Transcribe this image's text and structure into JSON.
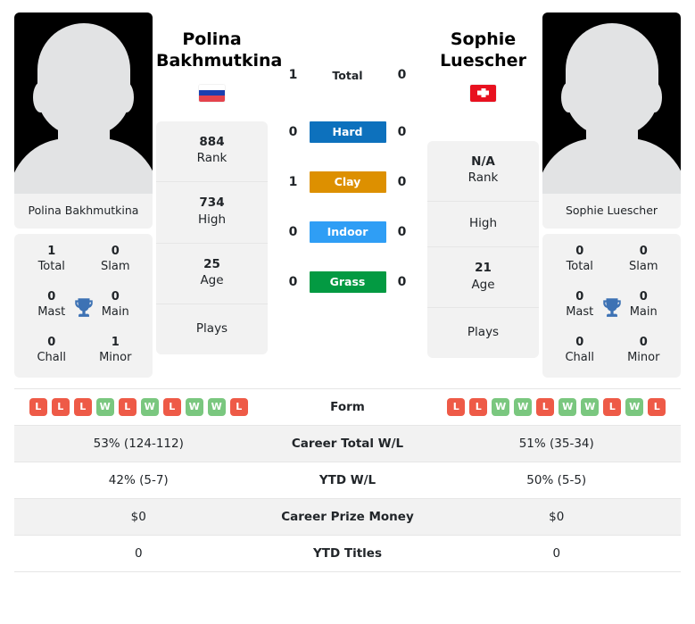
{
  "players": {
    "left": {
      "name": "Polina Bakhmutkina",
      "display_name_line1": "Polina",
      "display_name_line2": "Bakhmutkina",
      "country_flag": "russia-flag",
      "avatar": "player-avatar-placeholder",
      "titles": [
        {
          "value": "1",
          "label": "Total"
        },
        {
          "value": "0",
          "label": "Slam"
        },
        {
          "value": "0",
          "label": "Mast"
        },
        {
          "value": "0",
          "label": "Main"
        },
        {
          "value": "0",
          "label": "Chall"
        },
        {
          "value": "1",
          "label": "Minor"
        }
      ],
      "rank": {
        "value": "884",
        "label": "Rank"
      },
      "high": {
        "value": "734",
        "label": "High"
      },
      "age": {
        "value": "25",
        "label": "Age"
      },
      "plays": {
        "value": "",
        "label": "Plays"
      },
      "form": [
        "L",
        "L",
        "L",
        "W",
        "L",
        "W",
        "L",
        "W",
        "W",
        "L"
      ],
      "career_total_wl": "53% (124-112)",
      "ytd_wl": "42% (5-7)",
      "career_prize_money": "$0",
      "ytd_titles": "0",
      "surface_wins": {
        "total": "1",
        "hard": "0",
        "clay": "1",
        "indoor": "0",
        "grass": "0"
      }
    },
    "right": {
      "name": "Sophie Luescher",
      "display_name_line1": "Sophie",
      "display_name_line2": "Luescher",
      "country_flag": "switzerland-flag",
      "avatar": "player-avatar-placeholder",
      "titles": [
        {
          "value": "0",
          "label": "Total"
        },
        {
          "value": "0",
          "label": "Slam"
        },
        {
          "value": "0",
          "label": "Mast"
        },
        {
          "value": "0",
          "label": "Main"
        },
        {
          "value": "0",
          "label": "Chall"
        },
        {
          "value": "0",
          "label": "Minor"
        }
      ],
      "rank": {
        "value": "N/A",
        "label": "Rank"
      },
      "high": {
        "value": "",
        "label": "High"
      },
      "age": {
        "value": "21",
        "label": "Age"
      },
      "plays": {
        "value": "",
        "label": "Plays"
      },
      "form": [
        "L",
        "L",
        "W",
        "W",
        "L",
        "W",
        "W",
        "L",
        "W",
        "L"
      ],
      "career_total_wl": "51% (35-34)",
      "ytd_wl": "50% (5-5)",
      "career_prize_money": "$0",
      "ytd_titles": "0",
      "surface_wins": {
        "total": "0",
        "hard": "0",
        "clay": "0",
        "indoor": "0",
        "grass": "0"
      }
    }
  },
  "surfaces": {
    "total_label": "Total",
    "hard_label": "Hard",
    "clay_label": "Clay",
    "indoor_label": "Indoor",
    "grass_label": "Grass",
    "colors": {
      "hard": "#0d71bd",
      "clay": "#dd9000",
      "indoor": "#2f9ef5",
      "grass": "#039a42"
    }
  },
  "comparison": {
    "form_label": "Form",
    "career_total_wl_label": "Career Total W/L",
    "ytd_wl_label": "YTD W/L",
    "career_prize_money_label": "Career Prize Money",
    "ytd_titles_label": "YTD Titles"
  },
  "theme": {
    "win_color": "#7ac77f",
    "loss_color": "#ee5a47",
    "card_background": "#f2f2f2",
    "trophy_color": "#3d72b4"
  }
}
